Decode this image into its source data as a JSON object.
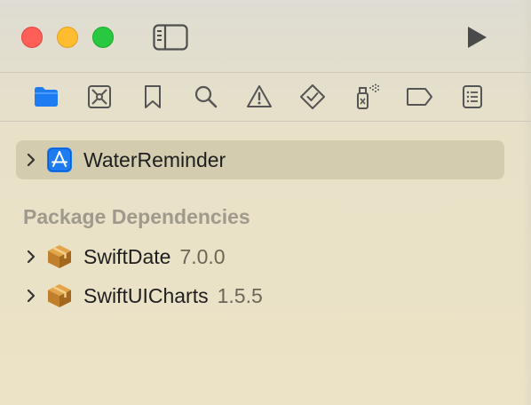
{
  "window": {
    "controls": [
      "close",
      "minimize",
      "zoom"
    ]
  },
  "toolbar": {
    "sidebar_toggle_icon": "sidebar-left-icon",
    "run_icon": "play-icon"
  },
  "navigator_tabs": [
    {
      "icon": "folder-icon",
      "selected": true
    },
    {
      "icon": "source-control-icon",
      "selected": false
    },
    {
      "icon": "bookmark-icon",
      "selected": false
    },
    {
      "icon": "search-icon",
      "selected": false
    },
    {
      "icon": "warning-icon",
      "selected": false
    },
    {
      "icon": "test-diamond-icon",
      "selected": false
    },
    {
      "icon": "debug-spray-icon",
      "selected": false
    },
    {
      "icon": "breakpoint-tag-icon",
      "selected": false
    },
    {
      "icon": "report-list-icon",
      "selected": false
    }
  ],
  "project": {
    "name": "WaterReminder",
    "icon": "app-project-icon"
  },
  "packages": {
    "header": "Package Dependencies",
    "items": [
      {
        "name": "SwiftDate",
        "version": "7.0.0",
        "icon": "package-icon"
      },
      {
        "name": "SwiftUICharts",
        "version": "1.5.5",
        "icon": "package-icon"
      }
    ]
  },
  "colors": {
    "accent": "#1d7cf2",
    "package_brown": "#c07f2a",
    "selection": "#d3ccaf"
  }
}
